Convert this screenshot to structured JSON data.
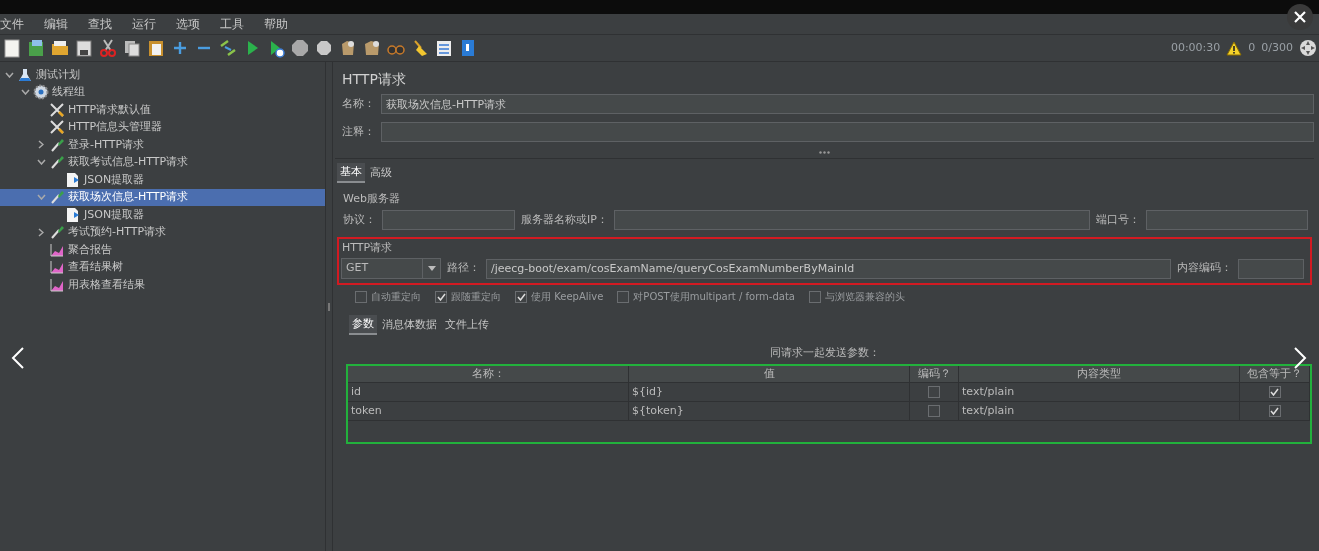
{
  "menu": [
    "文件",
    "编辑",
    "查找",
    "运行",
    "选项",
    "工具",
    "帮助"
  ],
  "status": {
    "elapsed": "00:00:30",
    "warnings": "0",
    "threads": "0/300"
  },
  "tree": [
    {
      "label": "测试计划",
      "kind": "plan",
      "expanded": true,
      "selected": false,
      "children": [
        {
          "label": "线程组",
          "kind": "thread",
          "expanded": true,
          "selected": false,
          "children": [
            {
              "label": "HTTP请求默认值",
              "kind": "config",
              "selected": false
            },
            {
              "label": "HTTP信息头管理器",
              "kind": "config",
              "selected": false
            },
            {
              "label": "登录-HTTP请求",
              "kind": "sampler",
              "expanded": false,
              "selected": false
            },
            {
              "label": "获取考试信息-HTTP请求",
              "kind": "sampler",
              "expanded": true,
              "selected": false,
              "children": [
                {
                  "label": "JSON提取器",
                  "kind": "extractor",
                  "selected": false
                }
              ]
            },
            {
              "label": "获取场次信息-HTTP请求",
              "kind": "sampler",
              "expanded": true,
              "selected": true,
              "children": [
                {
                  "label": "JSON提取器",
                  "kind": "extractor",
                  "selected": false
                }
              ]
            },
            {
              "label": "考试预约-HTTP请求",
              "kind": "sampler",
              "expanded": false,
              "selected": false
            },
            {
              "label": "聚合报告",
              "kind": "listener",
              "selected": false
            },
            {
              "label": "查看结果树",
              "kind": "listener",
              "selected": false
            },
            {
              "label": "用表格查看结果",
              "kind": "listener",
              "selected": false
            }
          ]
        }
      ]
    }
  ],
  "panel": {
    "title": "HTTP请求",
    "name_label": "名称：",
    "name_value": "获取场次信息-HTTP请求",
    "comment_label": "注释：",
    "tabs": [
      {
        "label": "基本",
        "selected": true
      },
      {
        "label": "高级",
        "selected": false
      }
    ],
    "web_server": {
      "legend": "Web服务器",
      "protocol_label": "协议：",
      "server_label": "服务器名称或IP：",
      "port_label": "端口号："
    },
    "http_request": {
      "legend": "HTTP请求",
      "method": "GET",
      "path_label": "路径：",
      "path_value": "/jeecg-boot/exam/cosExamName/queryCosExamNumberByMainId",
      "encoding_label": "内容编码："
    },
    "options": [
      {
        "label": "自动重定向",
        "checked": false
      },
      {
        "label": "跟随重定向",
        "checked": true
      },
      {
        "label": "使用 KeepAlive",
        "checked": true
      },
      {
        "label": "对POST使用multipart / form-data",
        "checked": false
      },
      {
        "label": "与浏览器兼容的头",
        "checked": false
      }
    ],
    "sub_tabs": [
      {
        "label": "参数",
        "selected": true
      },
      {
        "label": "消息体数据",
        "selected": false
      },
      {
        "label": "文件上传",
        "selected": false
      }
    ],
    "params": {
      "caption": "同请求一起发送参数：",
      "columns": [
        "名称：",
        "值",
        "编码？",
        "内容类型",
        "包含等于？"
      ],
      "rows": [
        {
          "name": "id",
          "value": "${id}",
          "encode": false,
          "content_type": "text/plain",
          "include_equals": true
        },
        {
          "name": "token",
          "value": "${token}",
          "encode": false,
          "content_type": "text/plain",
          "include_equals": true
        }
      ]
    }
  }
}
